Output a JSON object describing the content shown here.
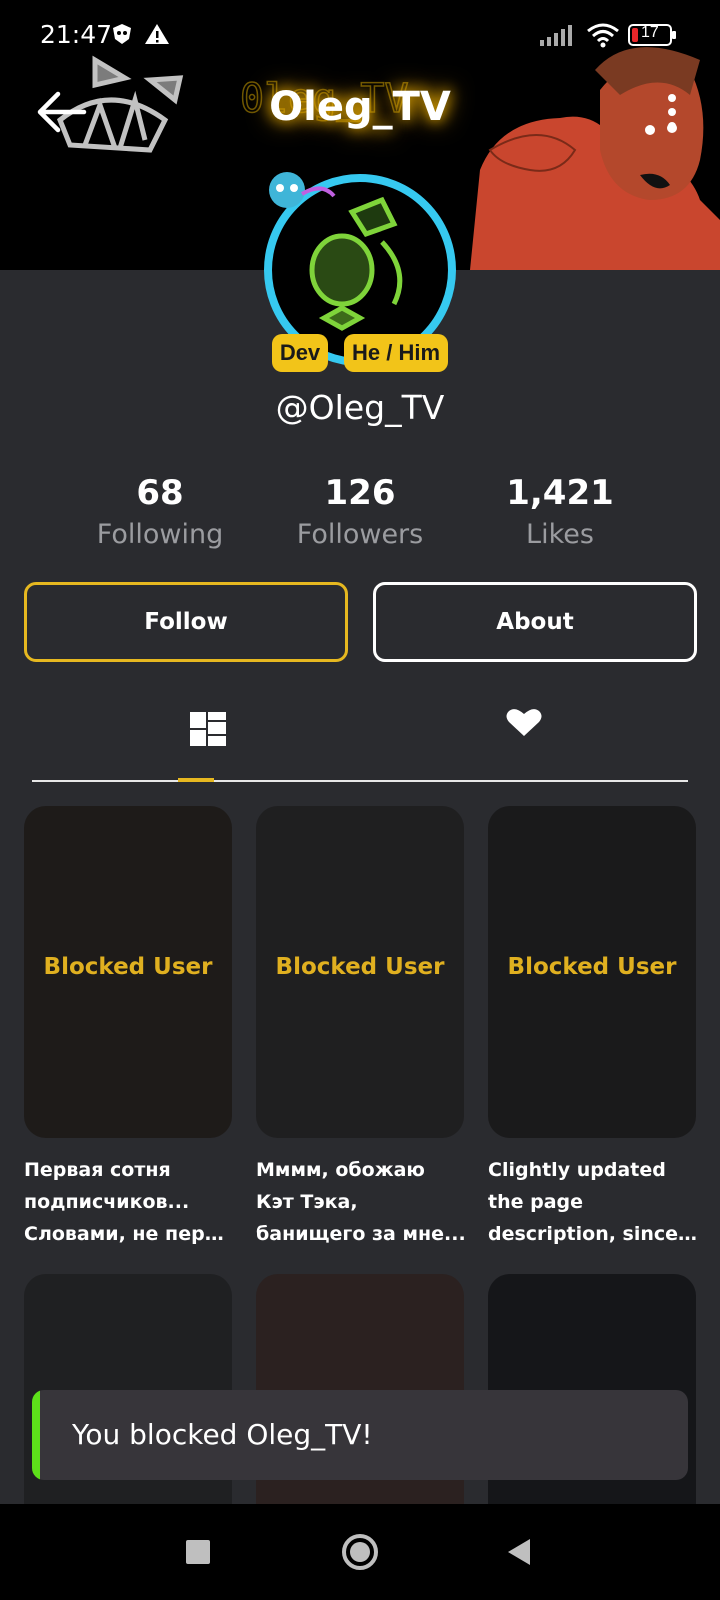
{
  "status_bar": {
    "time": "21:47",
    "battery_level": "17",
    "icons": [
      "shield-icon",
      "warning-icon",
      "signal-icon",
      "wifi-icon",
      "battery-icon"
    ]
  },
  "header": {
    "title": "Oleg_TV",
    "back_icon": "arrow-left-icon",
    "more_icon": "more-vertical-icon"
  },
  "profile": {
    "badges": [
      "Dev",
      "He / Him"
    ],
    "username": "@Oleg_TV",
    "stats": [
      {
        "value": "68",
        "label": "Following"
      },
      {
        "value": "126",
        "label": "Followers"
      },
      {
        "value": "1,421",
        "label": "Likes"
      }
    ]
  },
  "actions": {
    "follow_label": "Follow",
    "about_label": "About"
  },
  "tabs": [
    {
      "icon": "grid-icon",
      "selected": true
    },
    {
      "icon": "heart-icon",
      "selected": false
    }
  ],
  "posts": [
    {
      "overlay": "Blocked User",
      "caption_lines": [
        "Первая сотня",
        "подписчиков...",
        "Словами, не пере..."
      ]
    },
    {
      "overlay": "Blocked User",
      "caption_lines": [
        "Мммм, обожаю",
        "Кэт Тэка,",
        "банищего за мне..."
      ]
    },
    {
      "overlay": "Blocked User",
      "caption_lines": [
        "Clightly updated",
        "the page",
        "description, since ..."
      ]
    }
  ],
  "toast": {
    "message": "You blocked Oleg_TV!",
    "accent_color": "#5de01a"
  },
  "colors": {
    "background": "#2a2b2f",
    "accent": "#e6b820",
    "badge": "#f2c419"
  },
  "nav": [
    "square-icon",
    "circle-icon",
    "triangle-back-icon"
  ]
}
